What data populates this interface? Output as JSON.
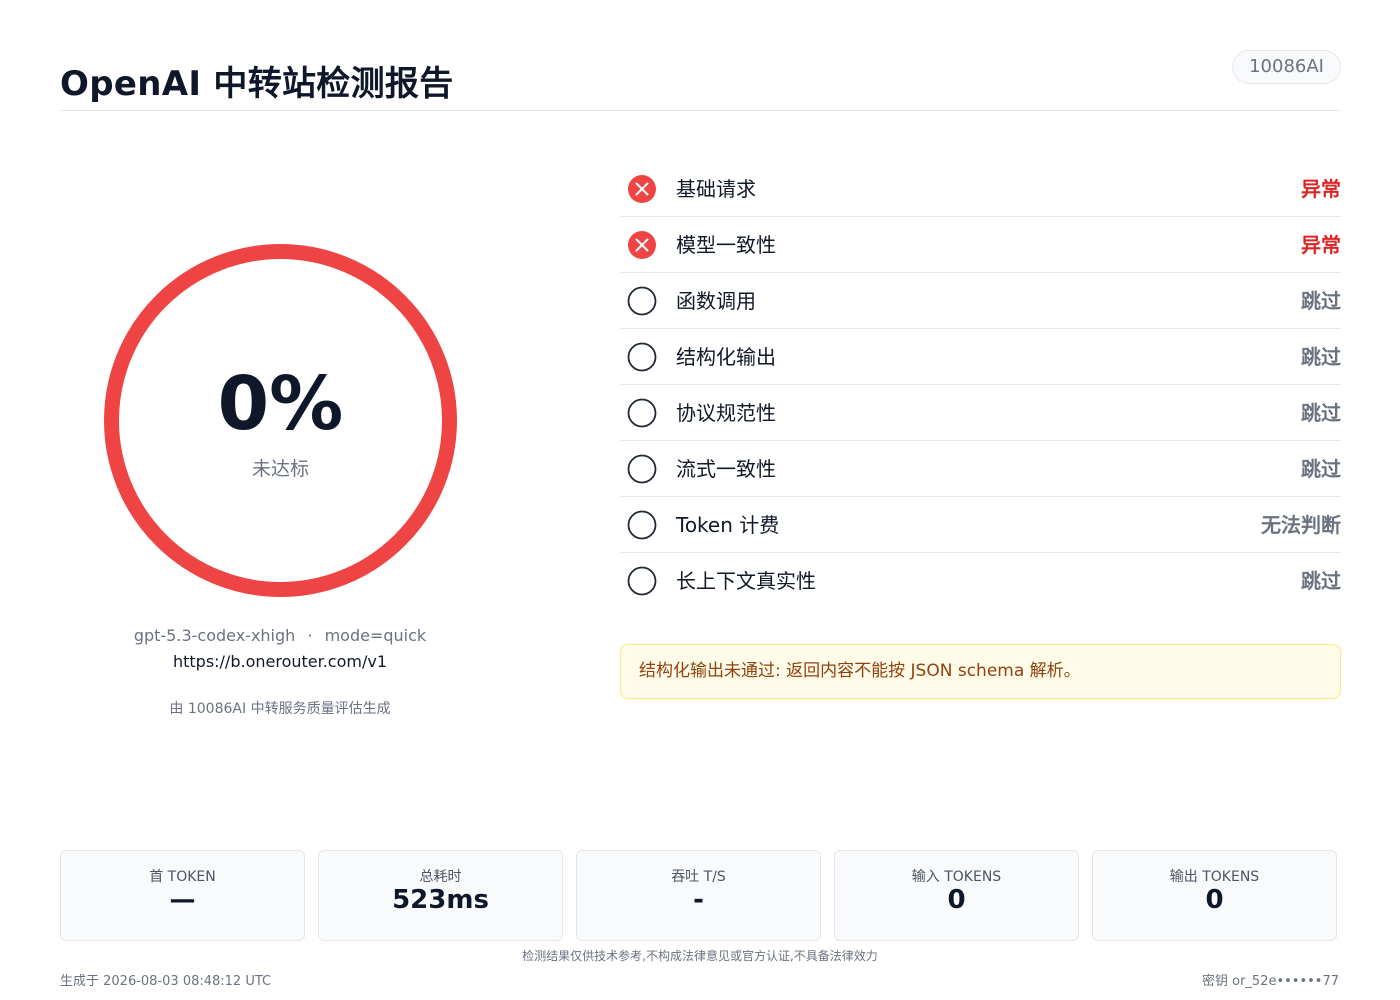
{
  "header": {
    "title": "OpenAI 中转站检测报告",
    "brand": "10086AI"
  },
  "score": {
    "value": "0%",
    "label": "未达标",
    "progress_percent": 0,
    "ring_color": "#ef4444"
  },
  "meta": {
    "model": "gpt-5.3-codex-xhigh",
    "separator": "·",
    "mode": "mode=quick",
    "endpoint": "https://b.onerouter.com/v1",
    "generated_by": "由 10086AI 中转服务质量评估生成"
  },
  "checks": [
    {
      "name": "基础请求",
      "status": "异常",
      "state": "fail",
      "icon": "x-circle-icon"
    },
    {
      "name": "模型一致性",
      "status": "异常",
      "state": "fail",
      "icon": "x-circle-icon"
    },
    {
      "name": "函数调用",
      "status": "跳过",
      "state": "skip",
      "icon": "empty-circle-icon"
    },
    {
      "name": "结构化输出",
      "status": "跳过",
      "state": "skip",
      "icon": "empty-circle-icon"
    },
    {
      "name": "协议规范性",
      "status": "跳过",
      "state": "skip",
      "icon": "empty-circle-icon"
    },
    {
      "name": "流式一致性",
      "status": "跳过",
      "state": "skip",
      "icon": "empty-circle-icon"
    },
    {
      "name": "Token 计费",
      "status": "无法判断",
      "state": "skip",
      "icon": "empty-circle-icon"
    },
    {
      "name": "长上下文真实性",
      "status": "跳过",
      "state": "skip",
      "icon": "empty-circle-icon"
    }
  ],
  "alert": {
    "message": "结构化输出未通过: 返回内容不能按 JSON schema 解析。"
  },
  "stats": [
    {
      "label": "首 TOKEN",
      "value": "—"
    },
    {
      "label": "总耗时",
      "value": "523ms"
    },
    {
      "label": "吞吐 T/S",
      "value": "-"
    },
    {
      "label": "输入 TOKENS",
      "value": "0"
    },
    {
      "label": "输出 TOKENS",
      "value": "0"
    }
  ],
  "footer": {
    "disclaimer": "检测结果仅供技术参考,不构成法律意见或官方认证,不具备法律效力",
    "generated_at": "生成于 2026-08-03 08:48:12 UTC",
    "key": "密钥 or_52e••••••77"
  },
  "colors": {
    "fail": "#dc2626",
    "fail_icon": "#ef4444",
    "skip": "#6b7280",
    "alert_bg": "#fefce8",
    "alert_text": "#92400e"
  }
}
